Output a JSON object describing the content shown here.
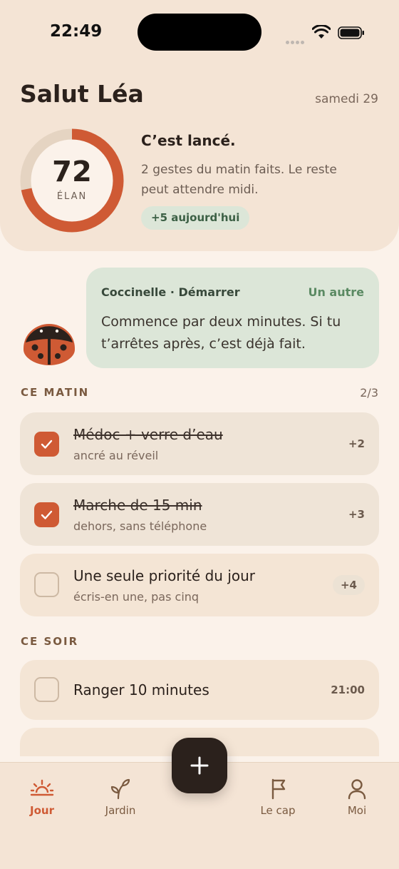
{
  "status_bar": {
    "time": "22:49"
  },
  "header": {
    "greeting": "Salut Léa",
    "date": "samedi 29",
    "score": {
      "value": "72",
      "label": "ÉLAN",
      "fraction": 0.72
    },
    "status_title": "C’est lancé.",
    "status_desc": "2 gestes du matin faits. Le reste peut attendre midi.",
    "today_gain": "+5 aujourd'hui"
  },
  "coach": {
    "name": "Coccinelle · Démarrer",
    "other_label": "Un autre",
    "message": "Commence par deux minutes. Si tu t’arrêtes après, c’est déjà fait."
  },
  "morning": {
    "title": "CE MATIN",
    "count": "2/3",
    "tasks": [
      {
        "title": "Médoc + verre d’eau",
        "subtitle": "ancré au réveil",
        "points": "+2",
        "done": true
      },
      {
        "title": "Marche de 15 min",
        "subtitle": "dehors, sans téléphone",
        "points": "+3",
        "done": true
      },
      {
        "title": "Une seule priorité du jour",
        "subtitle": "écris-en une, pas cinq",
        "points": "+4",
        "done": false
      }
    ]
  },
  "evening": {
    "title": "CE SOIR",
    "tasks": [
      {
        "title": "Ranger 10 minutes",
        "time": "21:00",
        "done": false
      }
    ]
  },
  "nav": {
    "items": [
      {
        "label": "Jour",
        "icon": "sun-icon",
        "active": true
      },
      {
        "label": "Jardin",
        "icon": "sprout-icon",
        "active": false
      },
      {
        "label": "Le cap",
        "icon": "flag-icon",
        "active": false
      },
      {
        "label": "Moi",
        "icon": "user-icon",
        "active": false
      }
    ],
    "add_icon": "plus-icon"
  },
  "colors": {
    "accent": "#CF5A34",
    "background": "#FBF2EA",
    "panel": "#F4E4D5",
    "coach_card": "#DCE6D8",
    "dark": "#2B211C"
  }
}
